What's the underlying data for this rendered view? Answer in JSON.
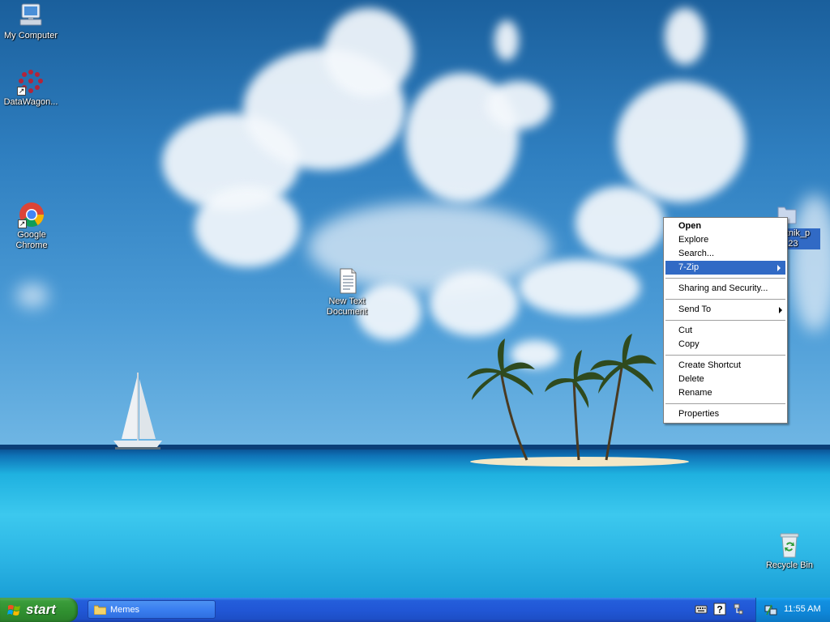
{
  "desktop": {
    "icons": [
      {
        "label": "My Computer"
      },
      {
        "label": "DataWagon..."
      },
      {
        "label": "Google Chrome"
      },
      {
        "label": "New Text\nDocument"
      },
      {
        "label_line1": "ratnik_p",
        "label_line2": "_123"
      },
      {
        "label": "Recycle Bin"
      }
    ]
  },
  "context_menu": {
    "items": [
      {
        "label": "Open"
      },
      {
        "label": "Explore"
      },
      {
        "label": "Search..."
      },
      {
        "label": "7-Zip"
      },
      {
        "label": "Sharing and Security..."
      },
      {
        "label": "Send To"
      },
      {
        "label": "Cut"
      },
      {
        "label": "Copy"
      },
      {
        "label": "Create Shortcut"
      },
      {
        "label": "Delete"
      },
      {
        "label": "Rename"
      },
      {
        "label": "Properties"
      }
    ],
    "highlight_color": "#316ac5"
  },
  "taskbar": {
    "start_label": "start",
    "tasks": [
      {
        "label": "Memes"
      }
    ],
    "clock": "11:55 AM"
  },
  "colors": {
    "taskbar_blue": "#245edb",
    "start_green": "#3b9c3b",
    "selection_blue": "#316ac5"
  }
}
